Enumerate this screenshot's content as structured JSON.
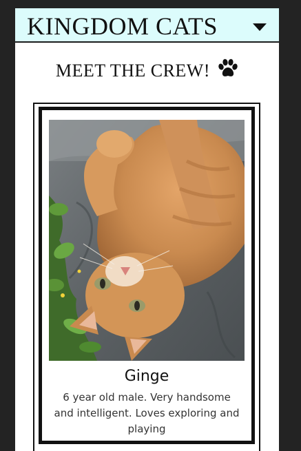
{
  "header": {
    "brand": "KINGDOM CATS",
    "menu_icon": "caret-down-icon",
    "background_color": "#dcfcfc"
  },
  "main": {
    "heading": "MEET THE CREW!",
    "heading_icon": "paw-icon"
  },
  "cat_card": {
    "photo_alt": "Ginger tabby cat lying on its back on a slate stone",
    "name": "Ginge",
    "description": "6 year old male. Very handsome and intelligent. Loves exploring and playing"
  },
  "colors": {
    "page_background": "#232323",
    "content_background": "#ffffff",
    "text": "#111111",
    "border": "#111111"
  }
}
